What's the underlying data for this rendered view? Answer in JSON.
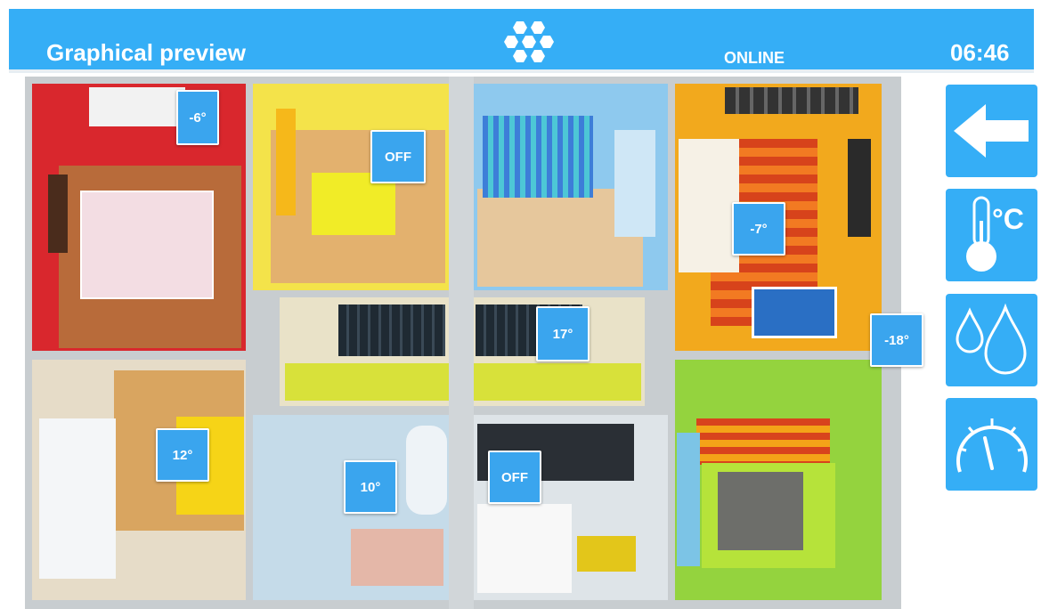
{
  "header": {
    "title": "Graphical preview",
    "status": "ONLINE",
    "time": "06:46",
    "logo_icon": "hexagon-cluster-icon"
  },
  "rooms": [
    {
      "name": "bedroom-red",
      "value": "-6°"
    },
    {
      "name": "kids-room-yellow",
      "value": "OFF"
    },
    {
      "name": "bedroom-blue",
      "value": "17°"
    },
    {
      "name": "living-room-orange",
      "value": "-7°"
    },
    {
      "name": "office",
      "value": "12°"
    },
    {
      "name": "bathroom",
      "value": "10°"
    },
    {
      "name": "laundry",
      "value": "OFF"
    },
    {
      "name": "hall",
      "value": "-18°"
    }
  ],
  "sidebar": {
    "buttons": [
      {
        "name": "back",
        "icon": "arrow-left-icon"
      },
      {
        "name": "temperature",
        "icon": "thermometer-icon",
        "unit": "°C"
      },
      {
        "name": "humidity",
        "icon": "water-drops-icon"
      },
      {
        "name": "gauge",
        "icon": "gauge-icon"
      }
    ]
  },
  "colors": {
    "accent": "#35aef6",
    "badge": "#3aa5ee"
  }
}
